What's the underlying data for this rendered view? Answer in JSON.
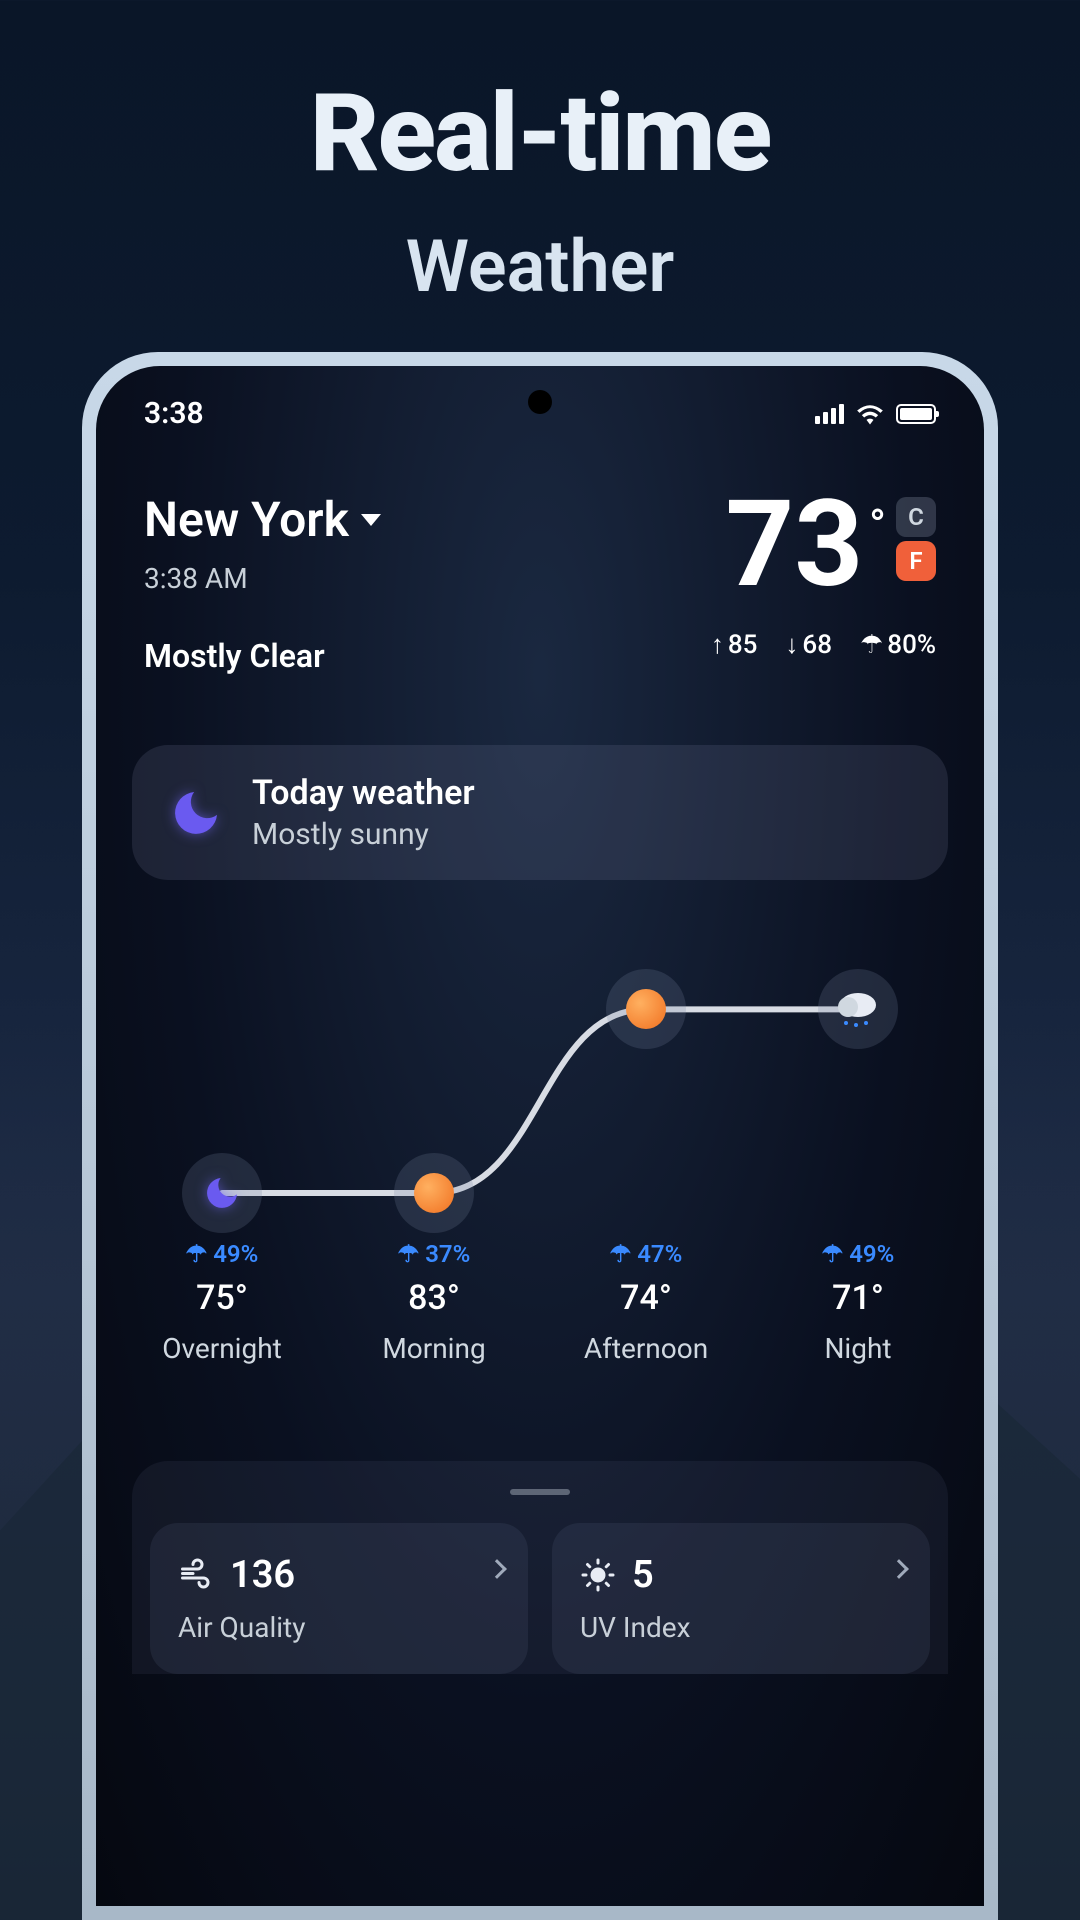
{
  "promo": {
    "headline_main": "Real-time",
    "headline_sub": "Weather"
  },
  "status": {
    "time": "3:38"
  },
  "location": {
    "name": "New York",
    "time": "3:38 AM",
    "condition": "Mostly Clear"
  },
  "temperature": {
    "value": "73",
    "unit_c": "C",
    "unit_f": "F",
    "active_unit": "F",
    "high": "85",
    "low": "68",
    "precip": "80%"
  },
  "today": {
    "title": "Today weather",
    "desc": "Mostly sunny"
  },
  "hourly": [
    {
      "label": "Overnight",
      "temp": "75°",
      "precip": "49%",
      "icon": "moon",
      "y": 0.9
    },
    {
      "label": "Morning",
      "temp": "83°",
      "precip": "37%",
      "icon": "sun",
      "y": 0.9
    },
    {
      "label": "Afternoon",
      "temp": "74°",
      "precip": "47%",
      "icon": "sun",
      "y": 0.22
    },
    {
      "label": "Night",
      "temp": "71°",
      "precip": "49%",
      "icon": "cloud-rain",
      "y": 0.22
    }
  ],
  "tiles": {
    "air_quality": {
      "label": "Air Quality",
      "value": "136"
    },
    "uv_index": {
      "label": "UV Index",
      "value": "5"
    }
  }
}
